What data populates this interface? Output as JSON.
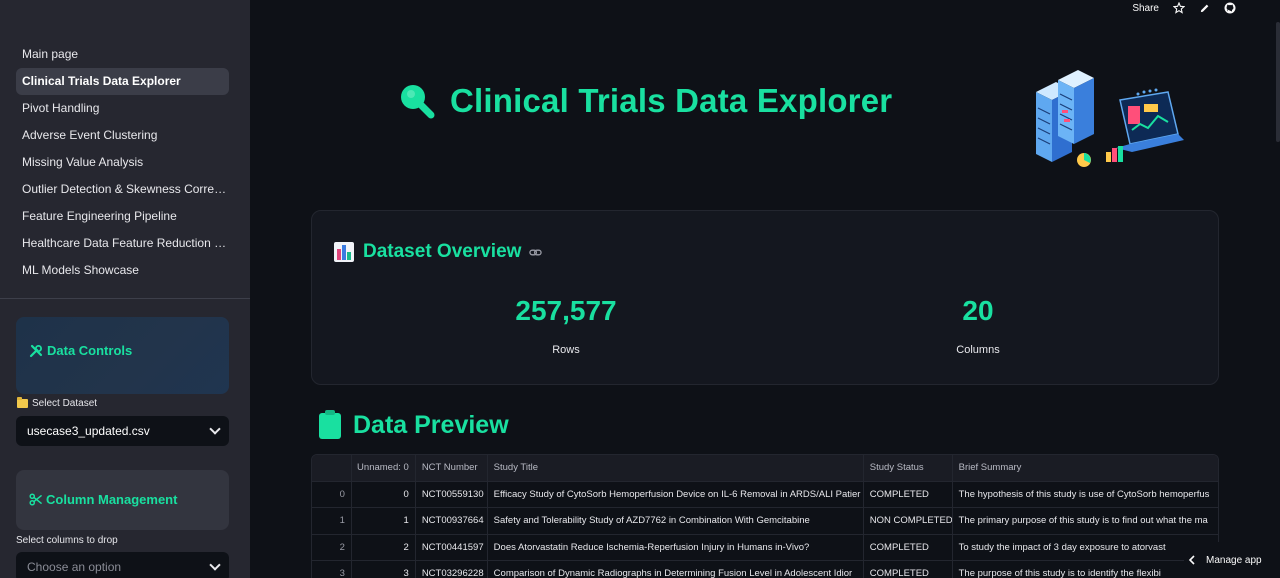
{
  "sidebar": {
    "nav": [
      {
        "label": "Main page",
        "active": false
      },
      {
        "label": "Clinical Trials Data Explorer",
        "active": true
      },
      {
        "label": "Pivot Handling",
        "active": false
      },
      {
        "label": "Adverse Event Clustering",
        "active": false
      },
      {
        "label": "Missing Value Analysis",
        "active": false
      },
      {
        "label": "Outlier Detection & Skewness Correct…",
        "active": false
      },
      {
        "label": "Feature Engineering Pipeline",
        "active": false
      },
      {
        "label": "Healthcare Data Feature Reduction J…",
        "active": false
      },
      {
        "label": "ML Models Showcase",
        "active": false
      }
    ],
    "data_controls": {
      "title": "Data Controls",
      "icon": "tools-icon"
    },
    "select_dataset": {
      "label": "Select Dataset",
      "icon": "folder-icon",
      "value": "usecase3_updated.csv"
    },
    "column_management": {
      "title": "Column Management",
      "icon": "scissors-icon"
    },
    "drop_columns": {
      "label": "Select columns to drop",
      "placeholder": "Choose an option"
    }
  },
  "toolbar": {
    "share_label": "Share"
  },
  "main": {
    "title": "Clinical Trials Data Explorer",
    "overview": {
      "title": "Dataset Overview",
      "rows_value": "257,577",
      "rows_label": "Rows",
      "cols_value": "20",
      "cols_label": "Columns"
    },
    "preview": {
      "title": "Data Preview",
      "headers": [
        "",
        "Unnamed: 0",
        "NCT Number",
        "Study Title",
        "Study Status",
        "Brief Summary"
      ],
      "rows": [
        [
          "0",
          "0",
          "NCT00559130",
          "Efficacy Study of CytoSorb Hemoperfusion Device on IL-6 Removal in ARDS/ALI Patier",
          "COMPLETED",
          "The hypothesis of this study is use of CytoSorb hemoperfus"
        ],
        [
          "1",
          "1",
          "NCT00937664",
          "Safety and Tolerability Study of AZD7762 in Combination With Gemcitabine",
          "NON COMPLETED",
          "The primary purpose of this study is to find out what the ma"
        ],
        [
          "2",
          "2",
          "NCT00441597",
          "Does Atorvastatin Reduce Ischemia-Reperfusion Injury in Humans in-Vivo?",
          "COMPLETED",
          "To study the impact of 3 day exposure to atorvast"
        ],
        [
          "3",
          "3",
          "NCT03296228",
          "Comparison of Dynamic Radiographs in Determining Fusion Level in Adolescent Idior",
          "COMPLETED",
          "The purpose of this study is to identify the flexibi"
        ]
      ]
    }
  },
  "footer": {
    "manage_app_label": "Manage app"
  },
  "colors": {
    "accent": "#19e0a0",
    "background": "#0e1117",
    "sidebar": "#262730"
  }
}
